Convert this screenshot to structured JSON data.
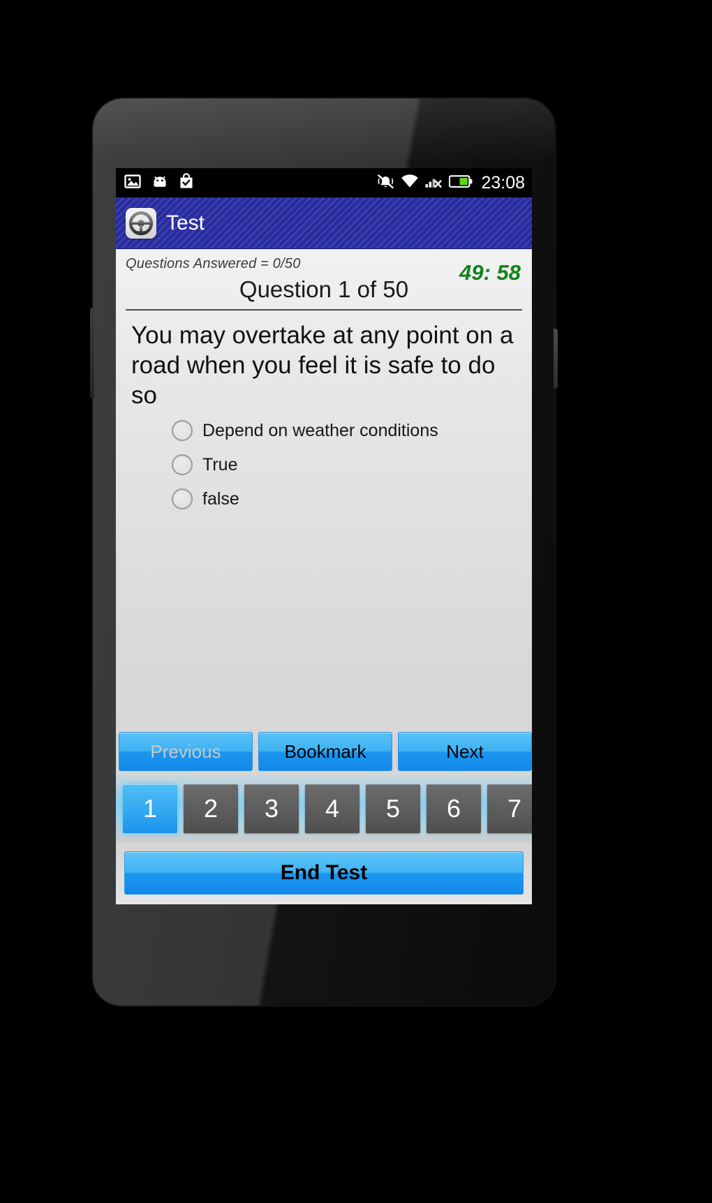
{
  "status_bar": {
    "clock": "23:08",
    "left_icons": [
      {
        "name": "gallery-icon",
        "label": "Gallery"
      },
      {
        "name": "android-head-icon",
        "label": "Android"
      },
      {
        "name": "play-store-bag-icon",
        "label": "Play Store"
      }
    ],
    "right_icons": [
      {
        "name": "vibrate-muted-icon",
        "label": "Silent / vibrate"
      },
      {
        "name": "wifi-icon",
        "label": "Wi-Fi"
      },
      {
        "name": "cellular-no-service-icon",
        "label": "No SIM signal"
      },
      {
        "name": "battery-icon",
        "label": "Battery"
      }
    ]
  },
  "app_bar": {
    "title": "Test",
    "icon_name": "steering-wheel-icon",
    "background_color": "#2b2fa8"
  },
  "quiz": {
    "answered_label": "Questions Answered = 0/50",
    "timer": "49: 58",
    "timer_color": "#13821b",
    "counter": "Question 1 of 50",
    "question_text": "You may overtake at any point on a road when you feel it is safe to do so",
    "options": [
      {
        "label": "Depend on weather conditions",
        "selected": false
      },
      {
        "label": "True",
        "selected": false
      },
      {
        "label": "false",
        "selected": false
      }
    ]
  },
  "nav_buttons": [
    {
      "label": "Previous",
      "disabled": true
    },
    {
      "label": "Bookmark",
      "disabled": false
    },
    {
      "label": "Next",
      "disabled": false
    }
  ],
  "number_strip": {
    "items": [
      "1",
      "2",
      "3",
      "4",
      "5",
      "6",
      "7"
    ],
    "active": "1",
    "active_color": "#36abf2",
    "inactive_color": "#5e5e5e"
  },
  "end_test": {
    "label": "End Test"
  }
}
